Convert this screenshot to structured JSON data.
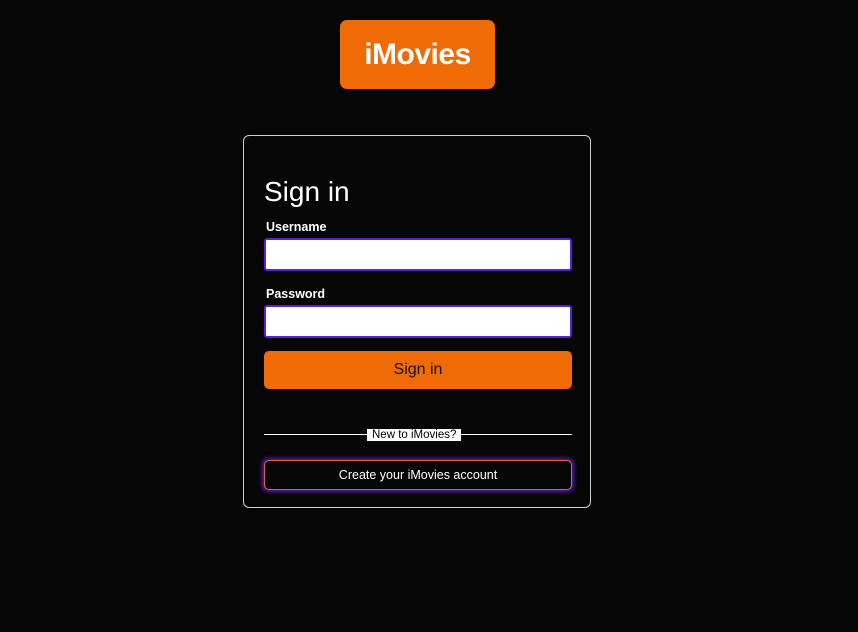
{
  "brand": {
    "logo_text": "iMovies",
    "accent_color": "#f06a06"
  },
  "signin": {
    "title": "Sign in",
    "username_label": "Username",
    "username_value": "",
    "password_label": "Password",
    "password_value": "",
    "submit_label": "Sign in"
  },
  "register": {
    "divider_text": "New to iMovies?",
    "create_label": "Create your iMovies account"
  }
}
